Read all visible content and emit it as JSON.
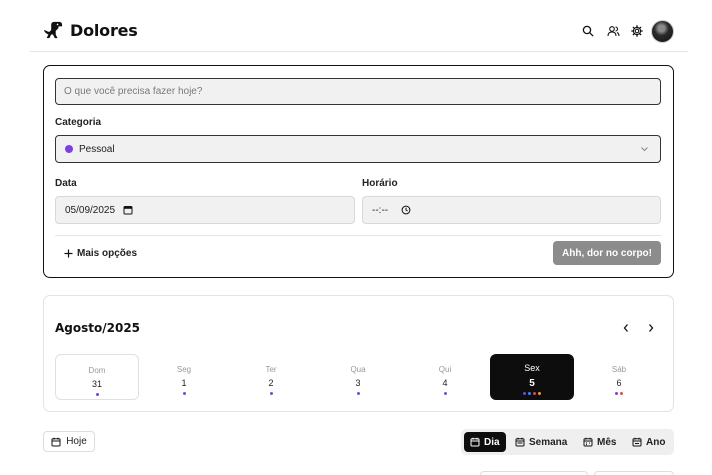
{
  "header": {
    "brand": "Dolores",
    "icons": [
      "search-icon",
      "users-icon",
      "gear-icon"
    ],
    "avatar": "user-avatar"
  },
  "form": {
    "task_placeholder": "O que você precisa fazer hoje?",
    "category_label": "Categoria",
    "category_value": "Pessoal",
    "category_color": "#7b3fe4",
    "date_label": "Data",
    "date_value": "05/09/2025",
    "time_label": "Horário",
    "time_value": "--:--",
    "more_options": "Mais opções",
    "submit_label": "Ahh, dor no corpo!"
  },
  "calendar": {
    "title": "Agosto/2025",
    "days": [
      {
        "name": "Dom",
        "num": "31",
        "dots": [
          "#7b3fe4"
        ]
      },
      {
        "name": "Seg",
        "num": "1",
        "dots": [
          "#5b5bd6"
        ]
      },
      {
        "name": "Ter",
        "num": "2",
        "dots": [
          "#5b5bd6"
        ]
      },
      {
        "name": "Qua",
        "num": "3",
        "dots": [
          "#5b5bd6"
        ]
      },
      {
        "name": "Qui",
        "num": "4",
        "dots": [
          "#5b5bd6"
        ]
      },
      {
        "name": "Sex",
        "num": "5",
        "dots": [
          "#7b3fe4",
          "#3b82f6",
          "#ef4444",
          "#f59e0b"
        ]
      },
      {
        "name": "Sáb",
        "num": "6",
        "dots": [
          "#7b3fe4",
          "#ef4444"
        ]
      }
    ]
  },
  "toolbar": {
    "today": "Hoje",
    "views": [
      "Dia",
      "Semana",
      "Mês",
      "Ano"
    ],
    "active_view": "Dia"
  }
}
